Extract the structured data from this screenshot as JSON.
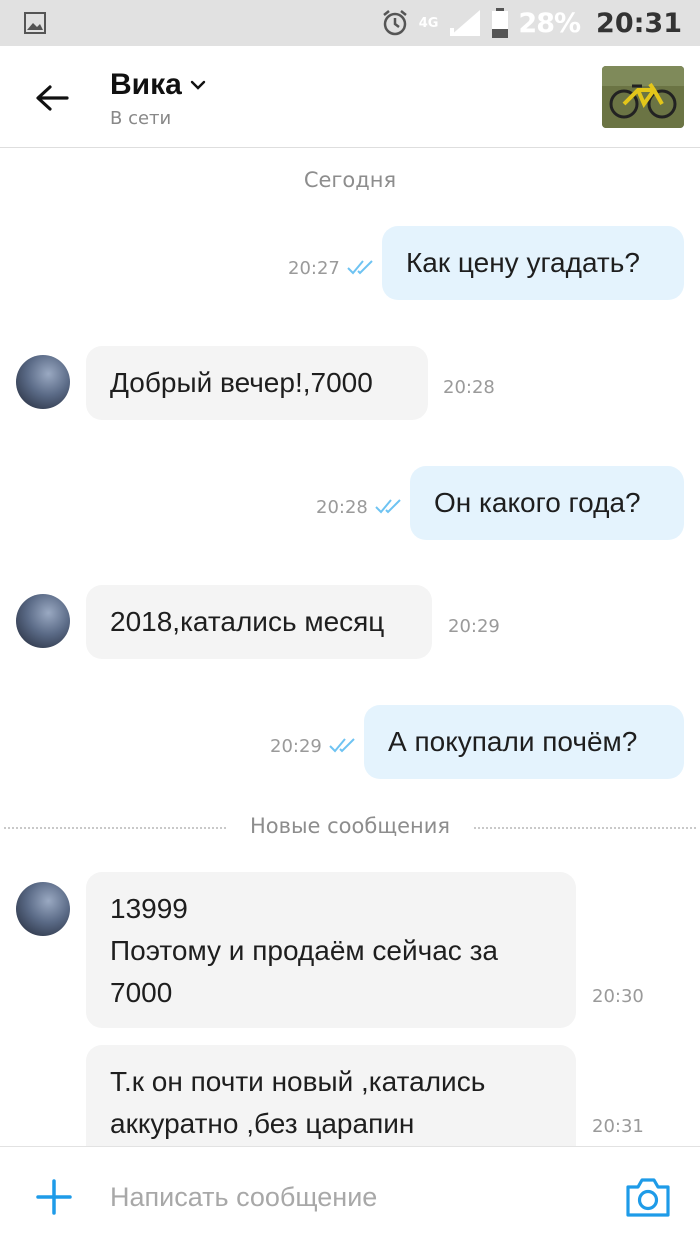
{
  "status_bar": {
    "network": "4G",
    "battery": "28%",
    "time": "20:31",
    "icons": [
      "image-icon",
      "alarm-icon",
      "signal-icon",
      "battery-icon"
    ]
  },
  "header": {
    "name": "Вика",
    "status": "В сети",
    "back_icon": "arrow-left-icon",
    "chevron_icon": "chevron-down-icon",
    "thumbnail": "listing-photo-bicycle"
  },
  "chat": {
    "day_label": "Сегодня",
    "new_messages_label": "Новые сообщения",
    "messages": [
      {
        "dir": "out",
        "text": "Как цену угадать?",
        "time": "20:27",
        "read": true
      },
      {
        "dir": "in",
        "text": "Добрый вечер!,7000",
        "time": "20:28"
      },
      {
        "dir": "out",
        "text": "Он какого года?",
        "time": "20:28",
        "read": true
      },
      {
        "dir": "in",
        "text": "2018,катались месяц",
        "time": "20:29"
      },
      {
        "dir": "out",
        "text": "А покупали почём?",
        "time": "20:29",
        "read": true
      },
      {
        "dir": "in",
        "text": "13999\nПоэтому и продаём сейчас за\n7000",
        "time": "20:30"
      },
      {
        "dir": "in",
        "text": "Т.к он почти новый ,катались\nаккуратно ,без царапин",
        "time": "20:31"
      }
    ]
  },
  "composer": {
    "placeholder": "Написать сообщение",
    "add_icon": "plus-icon",
    "camera_icon": "camera-icon"
  },
  "colors": {
    "accent": "#1e9be8",
    "outgoing_bubble": "#e4f3fd",
    "incoming_bubble": "#f4f4f4",
    "read_ticks": "#6ec3f2"
  }
}
